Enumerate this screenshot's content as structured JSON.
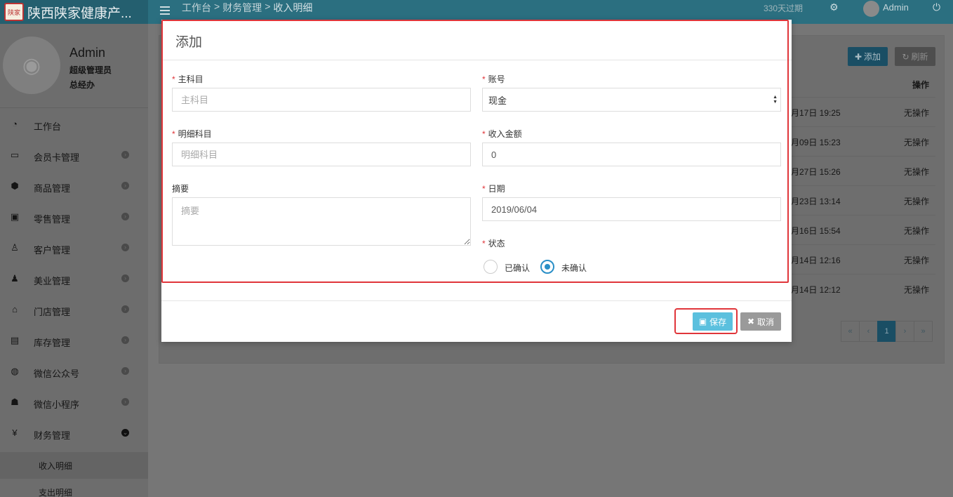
{
  "app": {
    "title": "陕西陕家健康产...",
    "logo_text": "陕家"
  },
  "header": {
    "breadcrumb": [
      "工作台",
      "财务管理",
      "收入明细"
    ],
    "breadcrumb_sep": ">",
    "expire_notice": "330天过期",
    "user": "Admin"
  },
  "profile": {
    "name": "Admin",
    "role": "超级管理员",
    "department": "总经办"
  },
  "sidebar": {
    "items": [
      {
        "label": "工作台",
        "icon": "dashboard-icon"
      },
      {
        "label": "会员卡管理",
        "icon": "credit-card-icon"
      },
      {
        "label": "商品管理",
        "icon": "cubes-icon"
      },
      {
        "label": "零售管理",
        "icon": "money-icon"
      },
      {
        "label": "客户管理",
        "icon": "male-icon"
      },
      {
        "label": "美业管理",
        "icon": "child-icon"
      },
      {
        "label": "门店管理",
        "icon": "home-icon"
      },
      {
        "label": "库存管理",
        "icon": "archive-icon"
      },
      {
        "label": "微信公众号",
        "icon": "wechat-icon"
      },
      {
        "label": "微信小程序",
        "icon": "users-icon"
      },
      {
        "label": "财务管理",
        "icon": "yen-icon"
      }
    ],
    "subitems": [
      {
        "label": "收入明细",
        "active": true
      },
      {
        "label": "支出明细",
        "active": false
      }
    ]
  },
  "panel": {
    "add_label": "添加",
    "refresh_label": "刷新",
    "ops_header": "操作",
    "rows": [
      {
        "date": "月17日 19:25",
        "ops": "无操作"
      },
      {
        "date": "月09日 15:23",
        "ops": "无操作"
      },
      {
        "date": "月27日 15:26",
        "ops": "无操作"
      },
      {
        "date": "月23日 13:14",
        "ops": "无操作"
      },
      {
        "date": "月16日 15:54",
        "ops": "无操作"
      },
      {
        "date": "月14日 12:16",
        "ops": "无操作"
      },
      {
        "date": "月14日 12:12",
        "ops": "无操作"
      }
    ],
    "pager": [
      "«",
      "‹",
      "1",
      "›",
      "»"
    ]
  },
  "modal": {
    "title": "添加",
    "fields": {
      "main_subject": {
        "label": "主科目",
        "placeholder": "主科目",
        "value": ""
      },
      "account": {
        "label": "账号",
        "value": "现金"
      },
      "detail_subject": {
        "label": "明细科目",
        "placeholder": "明细科目",
        "value": ""
      },
      "income_amount": {
        "label": "收入金额",
        "value": "0"
      },
      "summary": {
        "label": "摘要",
        "placeholder": "摘要",
        "value": ""
      },
      "date": {
        "label": "日期",
        "value": "2019/06/04"
      },
      "status": {
        "label": "状态",
        "options": [
          "已确认",
          "未确认"
        ],
        "selected": "未确认"
      }
    },
    "save_label": "保存",
    "cancel_label": "取消"
  },
  "colors": {
    "topbar": "#2b6f80",
    "highlight": "#e0353a",
    "save_button": "#5bc0de",
    "cancel_button": "#9a9a9a",
    "radio_checked": "#2a8fc7"
  }
}
